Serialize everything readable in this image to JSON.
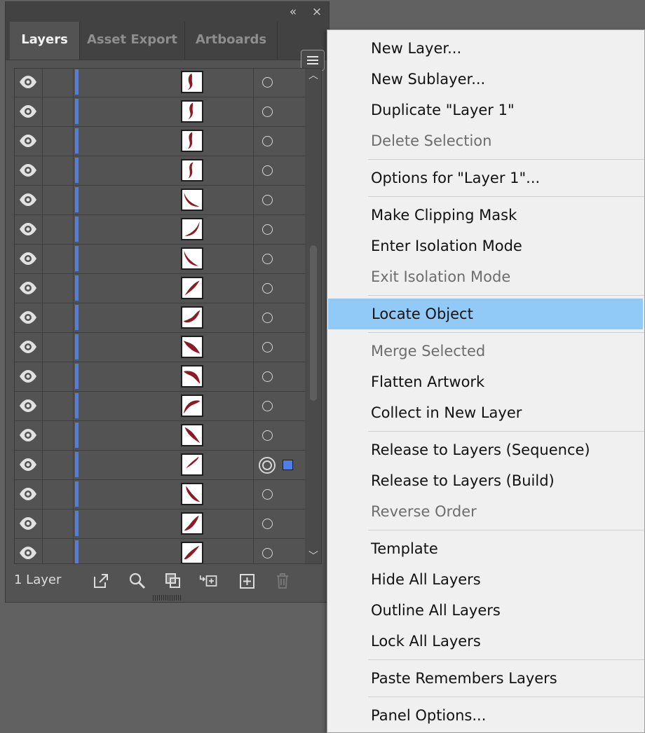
{
  "panel": {
    "controls": {
      "collapse": "«",
      "close": "×"
    },
    "tabs": [
      {
        "label": "Layers",
        "active": true
      },
      {
        "label": "Asset Export",
        "active": false
      },
      {
        "label": "Artboards",
        "active": false
      }
    ],
    "rows": [
      {
        "target": "circle"
      },
      {
        "target": "circle"
      },
      {
        "target": "circle"
      },
      {
        "target": "circle"
      },
      {
        "target": "circle"
      },
      {
        "target": "circle"
      },
      {
        "target": "circle"
      },
      {
        "target": "circle"
      },
      {
        "target": "circle"
      },
      {
        "target": "circle"
      },
      {
        "target": "circle"
      },
      {
        "target": "circle"
      },
      {
        "target": "circle"
      },
      {
        "target": "double-circle",
        "selected": true
      },
      {
        "target": "circle"
      },
      {
        "target": "circle"
      },
      {
        "target": "circle"
      }
    ],
    "footer": {
      "layer_count": "1 Layer",
      "buttons": [
        "export-icon",
        "locate-icon",
        "clipping-mask-icon",
        "new-sublayer-icon",
        "new-layer-icon",
        "delete-icon"
      ]
    },
    "colors": {
      "layer_color": "#4f7ee8",
      "thumb_art": "#8b1a24"
    }
  },
  "menu": {
    "items": [
      {
        "label": "New Layer...",
        "disabled": false
      },
      {
        "label": "New Sublayer...",
        "disabled": false
      },
      {
        "label": "Duplicate \"Layer 1\"",
        "disabled": false
      },
      {
        "label": "Delete Selection",
        "disabled": true
      },
      {
        "label": "Options for \"Layer 1\"...",
        "disabled": false
      },
      {
        "label": "Make Clipping Mask",
        "disabled": false
      },
      {
        "label": "Enter Isolation Mode",
        "disabled": false
      },
      {
        "label": "Exit Isolation Mode",
        "disabled": true
      },
      {
        "label": "Locate Object",
        "disabled": false,
        "highlighted": true
      },
      {
        "label": "Merge Selected",
        "disabled": true
      },
      {
        "label": "Flatten Artwork",
        "disabled": false
      },
      {
        "label": "Collect in New Layer",
        "disabled": false
      },
      {
        "label": "Release to Layers (Sequence)",
        "disabled": false
      },
      {
        "label": "Release to Layers (Build)",
        "disabled": false
      },
      {
        "label": "Reverse Order",
        "disabled": true
      },
      {
        "label": "Template",
        "disabled": false
      },
      {
        "label": "Hide All Layers",
        "disabled": false
      },
      {
        "label": "Outline All Layers",
        "disabled": false
      },
      {
        "label": "Lock All Layers",
        "disabled": false
      },
      {
        "label": "Paste Remembers Layers",
        "disabled": false
      },
      {
        "label": "Panel Options...",
        "disabled": false
      }
    ],
    "highlight_color": "#91c9f7"
  }
}
